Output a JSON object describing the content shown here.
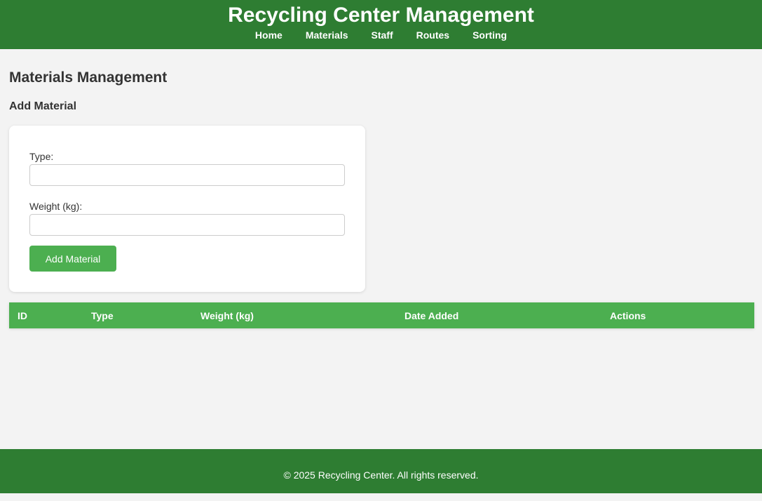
{
  "header": {
    "title": "Recycling Center Management",
    "nav": [
      "Home",
      "Materials",
      "Staff",
      "Routes",
      "Sorting"
    ]
  },
  "main": {
    "page_title": "Materials Management",
    "section_title": "Add Material",
    "form": {
      "type_label": "Type:",
      "type_value": "",
      "weight_label": "Weight (kg):",
      "weight_value": "",
      "submit_label": "Add Material"
    },
    "table": {
      "columns": [
        "ID",
        "Type",
        "Weight (kg)",
        "Date Added",
        "Actions"
      ],
      "rows": []
    }
  },
  "footer": {
    "text": "© 2025 Recycling Center. All rights reserved."
  },
  "colors": {
    "header_bg": "#2e7d32",
    "accent": "#4caf50",
    "page_bg": "#f3f3f3"
  }
}
